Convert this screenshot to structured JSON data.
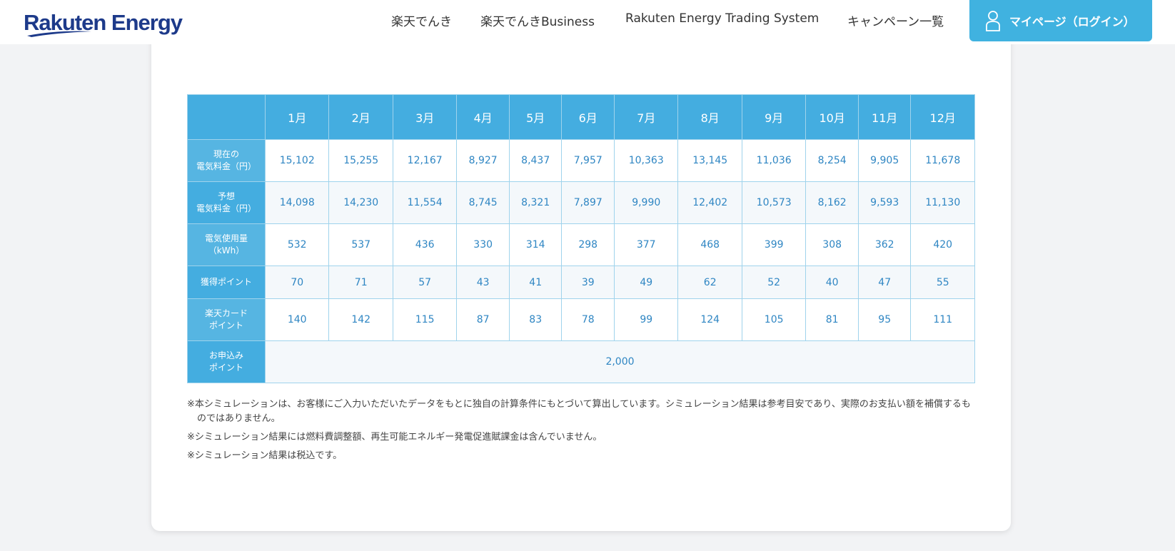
{
  "header": {
    "logo": "Rakuten Energy",
    "nav": [
      "楽天でんき",
      "楽天でんきBusiness",
      "Rakuten Energy Trading System",
      "キャンペーン一覧"
    ],
    "login_label": "マイページ（ログイン）",
    "accent_color": "#40b2e0",
    "logo_color": "#1d3a8a"
  },
  "table": {
    "months": [
      "1月",
      "2月",
      "3月",
      "4月",
      "5月",
      "6月",
      "7月",
      "8月",
      "9月",
      "10月",
      "11月",
      "12月"
    ],
    "rows": [
      {
        "label": [
          "現在の",
          "電気料金（円）"
        ],
        "values": [
          "15,102",
          "15,255",
          "12,167",
          "8,927",
          "8,437",
          "7,957",
          "10,363",
          "13,145",
          "11,036",
          "8,254",
          "9,905",
          "11,678"
        ]
      },
      {
        "label": [
          "予想",
          "電気料金（円）"
        ],
        "values": [
          "14,098",
          "14,230",
          "11,554",
          "8,745",
          "8,321",
          "7,897",
          "9,990",
          "12,402",
          "10,573",
          "8,162",
          "9,593",
          "11,130"
        ]
      },
      {
        "label": [
          "電気使用量",
          "（kWh）"
        ],
        "values": [
          "532",
          "537",
          "436",
          "330",
          "314",
          "298",
          "377",
          "468",
          "399",
          "308",
          "362",
          "420"
        ]
      },
      {
        "label": [
          "獲得ポイント"
        ],
        "values": [
          "70",
          "71",
          "57",
          "43",
          "41",
          "39",
          "49",
          "62",
          "52",
          "40",
          "47",
          "55"
        ]
      },
      {
        "label": [
          "楽天カード",
          "ポイント"
        ],
        "values": [
          "140",
          "142",
          "115",
          "87",
          "83",
          "78",
          "99",
          "124",
          "105",
          "81",
          "95",
          "111"
        ]
      }
    ],
    "application": {
      "label": [
        "お申込み",
        "ポイント"
      ],
      "value": "2,000"
    }
  },
  "notes": [
    "※本シミュレーションは、お客様にご入力いただいたデータをもとに独自の計算条件にもとづいて算出しています。シミュレーション結果は参考目安であり、実際のお支払い額を補償するものではありません。",
    "※シミュレーション結果には燃料費調整額、再生可能エネルギー発電促進賦課金は含んでいません。",
    "※シミュレーション結果は税込です。"
  ]
}
